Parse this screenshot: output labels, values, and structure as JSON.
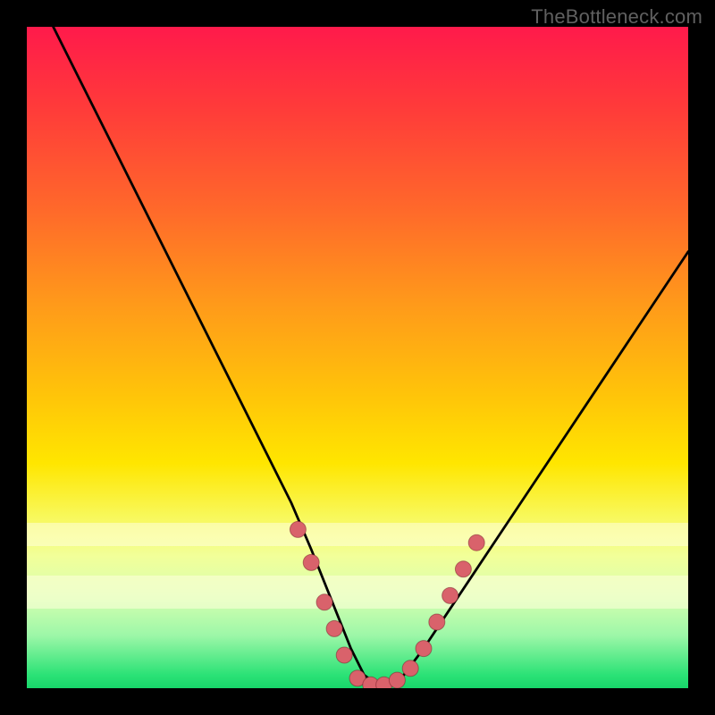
{
  "watermark": "TheBottleneck.com",
  "colors": {
    "frame": "#000000",
    "curve": "#000000",
    "dot_fill": "#d9626b",
    "dot_stroke": "rgba(120,30,40,0.5)"
  },
  "chart_data": {
    "type": "line",
    "title": "",
    "xlabel": "",
    "ylabel": "",
    "xlim": [
      0,
      100
    ],
    "ylim": [
      0,
      100
    ],
    "grid": false,
    "legend": false,
    "series": [
      {
        "name": "bottleneck-curve",
        "x": [
          4,
          8,
          12,
          16,
          20,
          24,
          28,
          32,
          36,
          40,
          43,
          45,
          47,
          49,
          51,
          53,
          55,
          57,
          60,
          64,
          68,
          72,
          76,
          80,
          84,
          88,
          92,
          96,
          100
        ],
        "y": [
          100,
          92,
          84,
          76,
          68,
          60,
          52,
          44,
          36,
          28,
          21,
          16,
          11,
          6,
          2,
          0.5,
          0.5,
          2,
          6,
          12,
          18,
          24,
          30,
          36,
          42,
          48,
          54,
          60,
          66
        ]
      }
    ],
    "markers": [
      {
        "name": "lower-left-1",
        "x": 41,
        "y": 24
      },
      {
        "name": "lower-left-2",
        "x": 43,
        "y": 19
      },
      {
        "name": "lower-left-3",
        "x": 45,
        "y": 13
      },
      {
        "name": "lower-left-4",
        "x": 46.5,
        "y": 9
      },
      {
        "name": "lower-left-5",
        "x": 48,
        "y": 5
      },
      {
        "name": "bottom-1",
        "x": 50,
        "y": 1.5
      },
      {
        "name": "bottom-2",
        "x": 52,
        "y": 0.5
      },
      {
        "name": "bottom-3",
        "x": 54,
        "y": 0.5
      },
      {
        "name": "bottom-4",
        "x": 56,
        "y": 1.2
      },
      {
        "name": "bottom-5",
        "x": 58,
        "y": 3
      },
      {
        "name": "lower-right-1",
        "x": 60,
        "y": 6
      },
      {
        "name": "lower-right-2",
        "x": 62,
        "y": 10
      },
      {
        "name": "lower-right-3",
        "x": 64,
        "y": 14
      },
      {
        "name": "lower-right-4",
        "x": 66,
        "y": 18
      },
      {
        "name": "lower-right-5",
        "x": 68,
        "y": 22
      }
    ],
    "pale_bands": [
      {
        "y_top": 25,
        "height": 3.5
      },
      {
        "y_top": 17,
        "height": 5
      }
    ]
  }
}
